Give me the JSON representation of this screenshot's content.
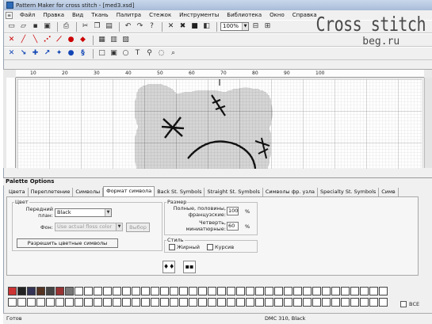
{
  "window": {
    "title": "Pattern Maker for cross stitch - [med3.xsd]"
  },
  "menu": [
    "Файл",
    "Правка",
    "Вид",
    "Ткань",
    "Палитра",
    "Стежок",
    "Инструменты",
    "Библиотека",
    "Окно",
    "Справка"
  ],
  "toolbar1_icons": [
    "new-file-icon",
    "open-file-icon",
    "save-icon",
    "save-all-icon",
    "print-icon",
    "cut-icon",
    "copy-icon",
    "paste-icon",
    "undo-icon",
    "redo-icon",
    "help-icon",
    "fabric-icon",
    "floss-icon",
    "color-icon",
    "zoom-out-icon",
    "zoom-in-icon"
  ],
  "toolbar1": {
    "zoom_value": "100%"
  },
  "toolbar2_icons": [
    "cross-stitch-icon",
    "half-stitch-icon",
    "quarter-stitch-icon",
    "three-quarter-stitch-icon",
    "back-stitch-icon",
    "french-knot-icon",
    "bead-icon",
    "line-icon",
    "rect-select-icon",
    "fill-icon"
  ],
  "toolbar3_icons": [
    "diagonal-icon",
    "diagonal-right-icon",
    "cross-blue-icon",
    "arrow-icon",
    "star-icon",
    "dot-icon",
    "s-icon",
    "rect-icon",
    "rect-fill-icon",
    "oval-icon",
    "text-icon",
    "magic-wand-icon",
    "lasso-icon",
    "magnify-icon"
  ],
  "watermark": {
    "line1": "Cross stitch",
    "line2": "beg.ru"
  },
  "ruler": {
    "numbers": [
      "10",
      "20",
      "30",
      "40",
      "50",
      "60",
      "70",
      "80",
      "90",
      "100"
    ]
  },
  "palette": {
    "title": "Palette Options",
    "tabs": [
      "Цвета",
      "Переплетение",
      "Символы",
      "Формат символа",
      "Back St. Symbols",
      "Straight St. Symbols",
      "Символы фр. узла",
      "Specialty St. Symbols",
      "Симв"
    ],
    "active_tab_index": 3,
    "color_group": {
      "legend": "Цвет",
      "foreground_label": "Передний план:",
      "foreground_value": "Black",
      "background_label": "Фон:",
      "background_value": "Use actual floss color",
      "bg_button": "Выбор",
      "allow_colored_symbols": "Разрешить цветные символы"
    },
    "size_group": {
      "legend": "Размер",
      "full_label": "Полные, половины, французские:",
      "full_value": "100",
      "quarter_label": "Четверть, миниатюрные:",
      "quarter_value": "60",
      "pct": "%"
    },
    "style_group": {
      "legend": "Стиль",
      "bold": "Жирный",
      "italic": "Курсив"
    },
    "preview1": "♦♦",
    "preview2": "▪▪"
  },
  "bottom": {
    "all_label": "ВСЕ"
  },
  "status": {
    "left": "Готов",
    "mid": "DMC  310, Black"
  }
}
